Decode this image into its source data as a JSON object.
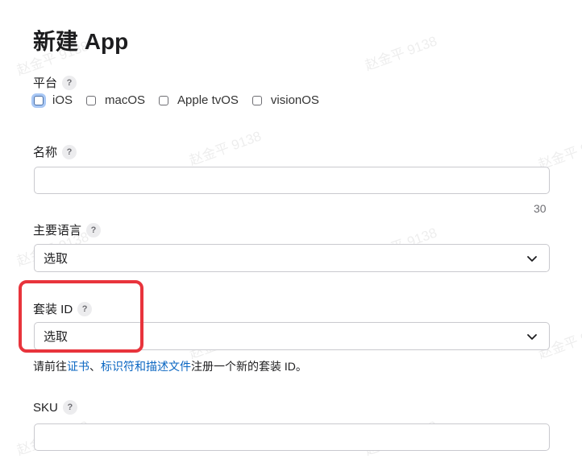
{
  "page_title": "新建 App",
  "platform": {
    "label": "平台",
    "help": "?",
    "options": [
      "iOS",
      "macOS",
      "Apple tvOS",
      "visionOS"
    ]
  },
  "name_field": {
    "label": "名称",
    "help": "?",
    "value": "",
    "char_limit": "30"
  },
  "primary_language": {
    "label": "主要语言",
    "help": "?",
    "value": "选取"
  },
  "bundle_id": {
    "label": "套装 ID",
    "help": "?",
    "value": "选取",
    "help_prefix": "请前往",
    "link1": "证书",
    "sep": "、",
    "link2": "标识符和描述文件",
    "help_suffix": "注册一个新的套装 ID。"
  },
  "sku": {
    "label": "SKU",
    "help": "?",
    "value": ""
  },
  "watermark": "赵金平 9138",
  "colors": {
    "link": "#0a66c2",
    "highlight_border": "#e8343c",
    "focus_ring": "#a9c8f5"
  }
}
